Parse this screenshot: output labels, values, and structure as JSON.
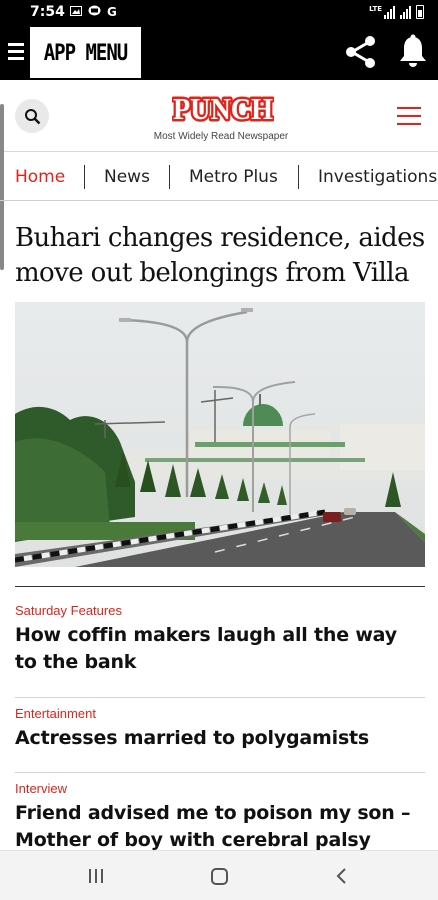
{
  "status": {
    "time": "7:54",
    "network": "LTE"
  },
  "app_bar": {
    "menu_label": "APP MENU"
  },
  "site": {
    "logo_text": "PUNCH",
    "tagline": "Most Widely Read Newspaper"
  },
  "tabs": [
    {
      "label": "Home",
      "active": true
    },
    {
      "label": "News",
      "active": false
    },
    {
      "label": "Metro Plus",
      "active": false
    },
    {
      "label": "Investigations",
      "active": false
    }
  ],
  "lead": {
    "headline": "Buhari changes residence, aides move out belongings from Villa"
  },
  "stories": [
    {
      "category": "Saturday Features",
      "title": "How coffin makers laugh all the way to the bank"
    },
    {
      "category": "Entertainment",
      "title": "Actresses married to polygamists"
    },
    {
      "category": "Interview",
      "title": "Friend advised me to poison my son – Mother of boy with cerebral palsy"
    }
  ],
  "colors": {
    "accent": "#e2231a",
    "bar": "#000000"
  }
}
